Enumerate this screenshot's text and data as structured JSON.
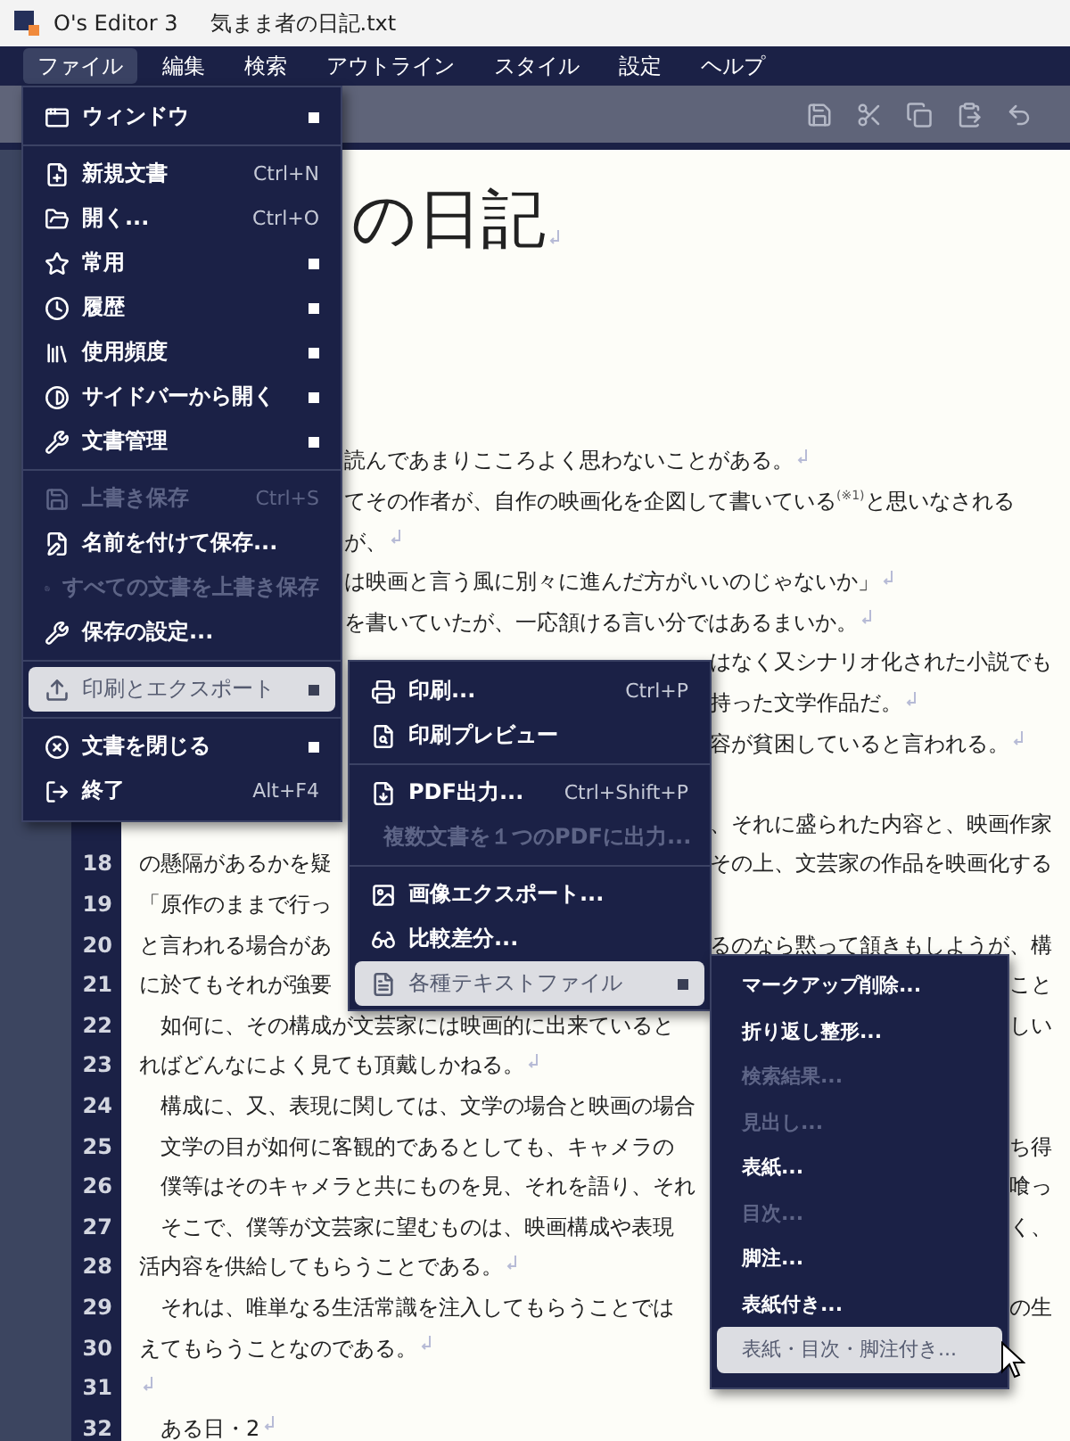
{
  "title_bar": {
    "app_name": "O's Editor 3",
    "document": "気まま者の日記.txt"
  },
  "menu_bar": [
    {
      "label": "ファイル",
      "selected": true
    },
    {
      "label": "編集",
      "selected": false
    },
    {
      "label": "検索",
      "selected": false
    },
    {
      "label": "アウトライン",
      "selected": false
    },
    {
      "label": "スタイル",
      "selected": false
    },
    {
      "label": "設定",
      "selected": false
    },
    {
      "label": "ヘルプ",
      "selected": false
    }
  ],
  "document": {
    "title": "の日記",
    "title_eol": true,
    "lines": [
      {
        "left": "読んであまりこころよく思わないことがある。",
        "eol": true
      },
      {
        "left": "てその作者が、自作の映画化を企図して書いている$^{(※1)}$と思いなされる",
        "eol": false
      },
      {
        "left": "が、",
        "eol": true
      },
      {
        "left": "は映画と言う風に別々に進んだ方がいいのじゃないか」",
        "eol": true
      },
      {
        "left": "を書いていたが、一応頷ける言い分ではあるまいか。",
        "eol": true
      },
      {
        "right": "はなく又シナリオ化された小説でも",
        "eol": false
      },
      {
        "right": "持った文学作品だ。",
        "eol": true
      },
      {
        "right": "容が貧困していると言われる。",
        "eol": true
      },
      {
        "eol": false
      },
      {
        "right": "、それに盛られた内容と、映画作家",
        "eol": false
      },
      {
        "number": "18",
        "left": "の懸隔があるかを疑",
        "right": "その上、文芸家の作品を映画化する",
        "eol": false
      },
      {
        "number": "19",
        "left": "「原作のままで行っ",
        "eol": false
      },
      {
        "number": "20",
        "left": "と言われる場合があ",
        "right": "るのなら黙って頷きもしようが、構",
        "eol": false
      },
      {
        "number": "21",
        "left": "に於てもそれが強要",
        "right": "こと",
        "eol": false
      },
      {
        "number": "22",
        "left": "　如何に、その構成が文芸家には映画的に出来ていると",
        "right": "しい",
        "eol": false
      },
      {
        "number": "23",
        "left": "ればどんなによく見ても頂戴しかねる。",
        "eol": true
      },
      {
        "number": "24",
        "left": "　構成に、又、表現に関しては、文学の場合と映画の場合",
        "eol": false
      },
      {
        "number": "25",
        "left": "　文学の目が如何に客観的であるとしても、キャメラの",
        "right": "ち得",
        "eol": false
      },
      {
        "number": "26",
        "left": "　僕等はそのキャメラと共にものを見、それを語り、それ",
        "right": "喰っ",
        "eol": false
      },
      {
        "number": "27",
        "left": "　そこで、僕等が文芸家に望むものは、映画構成や表現",
        "right": "く、",
        "eol": false
      },
      {
        "number": "28",
        "left": "活内容を供給してもらうことである。",
        "eol": true
      },
      {
        "number": "29",
        "left": "　それは、唯単なる生活常識を注入してもらうことでは",
        "right": "の生",
        "eol": false
      },
      {
        "number": "30",
        "left": "えてもらうことなのである。",
        "eol": true
      },
      {
        "number": "31",
        "eol": true
      },
      {
        "number": "32",
        "left": "　ある日・2",
        "eol": true
      }
    ]
  },
  "file_menu": {
    "groups": [
      {
        "items": [
          {
            "label": "ウィンドウ",
            "submenu": true,
            "disabled": false,
            "selected": false
          }
        ]
      },
      {
        "items": [
          {
            "label": "新規文書",
            "shortcut": "Ctrl+N",
            "submenu": false,
            "disabled": false,
            "selected": false
          },
          {
            "label": "開く...",
            "shortcut": "Ctrl+O",
            "submenu": false,
            "disabled": false,
            "selected": false
          },
          {
            "label": "常用",
            "submenu": true,
            "disabled": false,
            "selected": false
          },
          {
            "label": "履歴",
            "submenu": true,
            "disabled": false,
            "selected": false
          },
          {
            "label": "使用頻度",
            "submenu": true,
            "disabled": false,
            "selected": false
          },
          {
            "label": "サイドバーから開く",
            "submenu": true,
            "disabled": false,
            "selected": false
          },
          {
            "label": "文書管理",
            "submenu": true,
            "disabled": false,
            "selected": false
          }
        ]
      },
      {
        "items": [
          {
            "label": "上書き保存",
            "shortcut": "Ctrl+S",
            "submenu": false,
            "disabled": true,
            "selected": false
          },
          {
            "label": "名前を付けて保存...",
            "submenu": false,
            "disabled": false,
            "selected": false
          },
          {
            "label": "すべての文書を上書き保存",
            "submenu": false,
            "disabled": true,
            "selected": false
          },
          {
            "label": "保存の設定...",
            "submenu": false,
            "disabled": false,
            "selected": false
          }
        ]
      },
      {
        "items": [
          {
            "label": "印刷とエクスポート",
            "submenu": true,
            "disabled": false,
            "selected": true
          }
        ]
      },
      {
        "items": [
          {
            "label": "文書を閉じる",
            "submenu": true,
            "disabled": false,
            "selected": false
          },
          {
            "label": "終了",
            "shortcut": "Alt+F4",
            "submenu": false,
            "disabled": false,
            "selected": false
          }
        ]
      }
    ]
  },
  "export_menu": {
    "groups": [
      {
        "items": [
          {
            "label": "印刷...",
            "shortcut": "Ctrl+P",
            "submenu": false,
            "disabled": false,
            "selected": false
          },
          {
            "label": "印刷プレビュー",
            "submenu": false,
            "disabled": false,
            "selected": false
          }
        ]
      },
      {
        "items": [
          {
            "label": "PDF出力...",
            "shortcut": "Ctrl+Shift+P",
            "submenu": false,
            "disabled": false,
            "selected": false
          },
          {
            "label": "複数文書を１つのPDFに出力...",
            "submenu": false,
            "disabled": true,
            "selected": false
          }
        ]
      },
      {
        "items": [
          {
            "label": "画像エクスポート...",
            "submenu": false,
            "disabled": false,
            "selected": false
          },
          {
            "label": "比較差分...",
            "submenu": false,
            "disabled": false,
            "selected": false
          },
          {
            "label": "各種テキストファイル",
            "submenu": true,
            "disabled": false,
            "selected": true
          }
        ]
      }
    ]
  },
  "text_file_menu": {
    "groups": [
      {
        "items": [
          {
            "label": "マークアップ削除...",
            "submenu": false,
            "disabled": false,
            "selected": false
          },
          {
            "label": "折り返し整形...",
            "submenu": false,
            "disabled": false,
            "selected": false
          },
          {
            "label": "検索結果...",
            "submenu": false,
            "disabled": true,
            "selected": false
          },
          {
            "label": "見出し...",
            "submenu": false,
            "disabled": true,
            "selected": false
          },
          {
            "label": "表紙...",
            "submenu": false,
            "disabled": false,
            "selected": false
          },
          {
            "label": "目次...",
            "submenu": false,
            "disabled": true,
            "selected": false
          },
          {
            "label": "脚注...",
            "submenu": false,
            "disabled": false,
            "selected": false
          },
          {
            "label": "表紙付き...",
            "submenu": false,
            "disabled": false,
            "selected": false
          },
          {
            "label": "表紙・目次・脚注付き...",
            "submenu": false,
            "disabled": false,
            "selected": true
          }
        ]
      }
    ]
  }
}
